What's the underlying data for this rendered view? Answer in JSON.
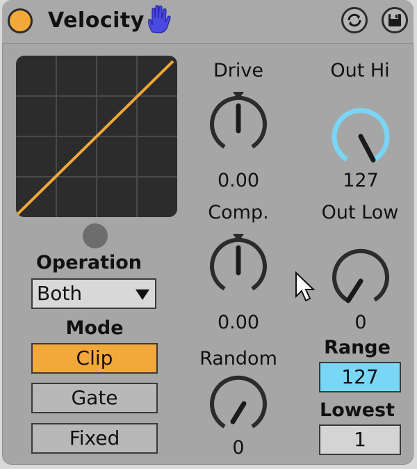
{
  "device": {
    "title": "Velocity",
    "icons": {
      "power": "power-toggle-icon",
      "hand": "hand-icon",
      "hot_swap": "hot-swap-icon",
      "save": "save-preset-icon"
    },
    "colors": {
      "accent": "#f3a83a",
      "blue": "#4a4ae0",
      "cyan": "#7ad6f5",
      "panel": "#a6a6a6",
      "display": "#2c2c2c"
    }
  },
  "operation": {
    "label": "Operation",
    "value": "Both"
  },
  "mode": {
    "label": "Mode",
    "options": [
      "Clip",
      "Gate",
      "Fixed"
    ],
    "selected": "Clip"
  },
  "knobs": {
    "drive": {
      "label": "Drive",
      "value": "0.00",
      "level": 0.5
    },
    "comp": {
      "label": "Comp.",
      "value": "0.00",
      "level": 0.5
    },
    "random": {
      "label": "Random",
      "value": "0",
      "level": 0
    },
    "out_hi": {
      "label": "Out Hi",
      "value": "127",
      "level": 1.0
    },
    "out_low": {
      "label": "Out Low",
      "value": "0",
      "level": 0
    }
  },
  "range": {
    "label": "Range",
    "value": "127"
  },
  "lowest": {
    "label": "Lowest",
    "value": "1"
  }
}
